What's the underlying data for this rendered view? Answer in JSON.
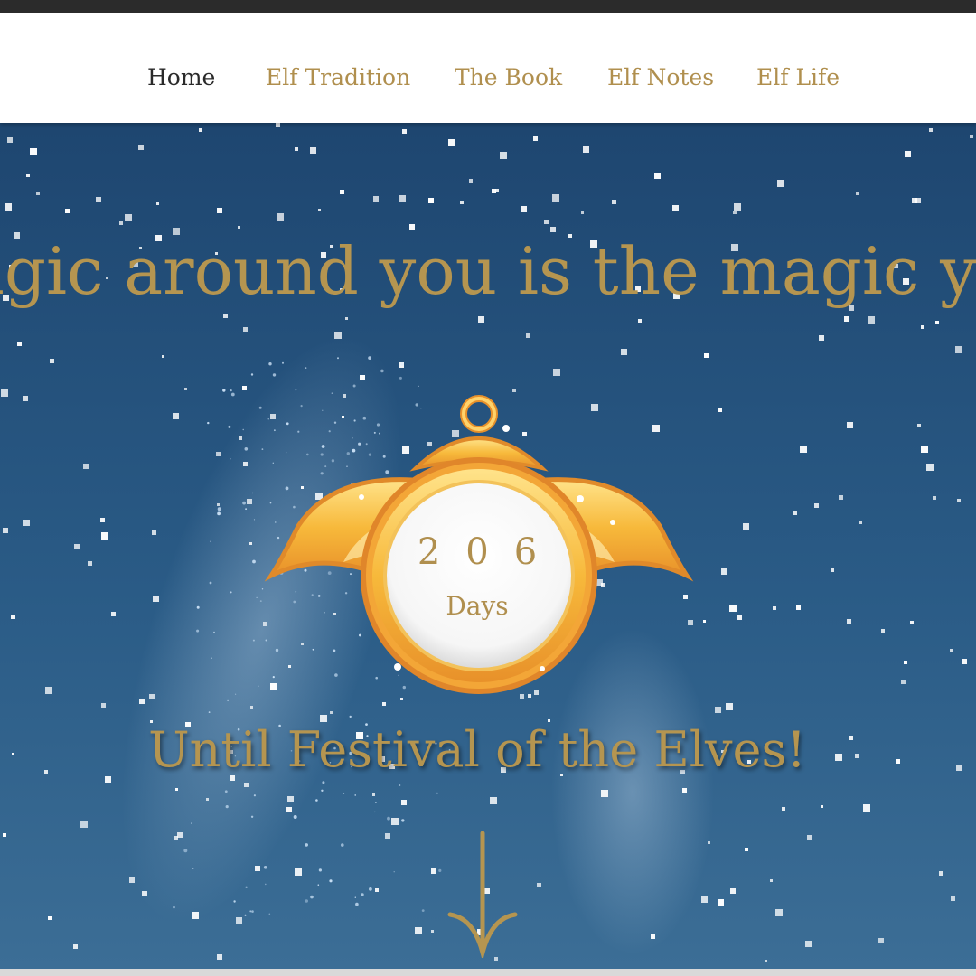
{
  "nav": {
    "items": [
      {
        "label": "Home",
        "active": true
      },
      {
        "label": "Elf Tradition",
        "active": false
      },
      {
        "label": "The Book",
        "active": false
      },
      {
        "label": "Elf Notes",
        "active": false
      },
      {
        "label": "Elf Life",
        "active": false
      }
    ]
  },
  "hero": {
    "quote": "agic around you is the magic you",
    "countdown": {
      "value": "206",
      "unit": "Days"
    },
    "subtitle": "Until Festival of the Elves!"
  },
  "icons": {
    "medallion": "golden-locket-icon",
    "scroll": "arrow-down-icon"
  },
  "colors": {
    "gold": "#b59550",
    "nav_active": "#2a2a2a",
    "sky_top": "#1e4670",
    "sky_bottom": "#3c6e96"
  }
}
